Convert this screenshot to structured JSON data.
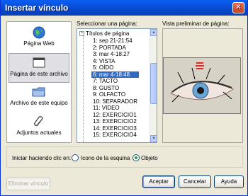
{
  "window": {
    "title": "Insertar vínculo",
    "close_glyph": "✕"
  },
  "nav": {
    "items": [
      {
        "label": "Página Web",
        "icon": "globe-icon"
      },
      {
        "label": "Página de este archivo",
        "icon": "document-icon",
        "selected": true
      },
      {
        "label": "Archivo de este equipo",
        "icon": "folder-icon"
      },
      {
        "label": "Adjuntos actuales",
        "icon": "paperclip-icon"
      }
    ]
  },
  "tree": {
    "label": "Seleccionar una página:",
    "root": "Títulos de página",
    "expander": "−",
    "items": [
      "1: sep 21-21:54",
      "2: PORTADA",
      "3: mar 4-18:27",
      "4: VISTA",
      "5: OÍDO",
      "6: mar 4-18:48",
      "7: TACTO",
      "8: GUSTO",
      "9: OLFACTO",
      "10: SEPARADOR",
      "11: VIDEO",
      "12: EXERCICIO1",
      "13: EXERCICIO2",
      "14: EXERCICIO3",
      "15: EXERCICIO4"
    ],
    "selected_index": 5
  },
  "preview": {
    "label": "Vista preliminar de página:"
  },
  "start": {
    "label": "Iniciar haciendo clic en:",
    "option_corner": "Icono de la esquina",
    "option_object": "Objeto",
    "selected": "Objeto"
  },
  "buttons": {
    "remove": "Eliminar vínculo",
    "ok": "Aceptar",
    "cancel": "Cancelar",
    "help": "Ayuda"
  }
}
